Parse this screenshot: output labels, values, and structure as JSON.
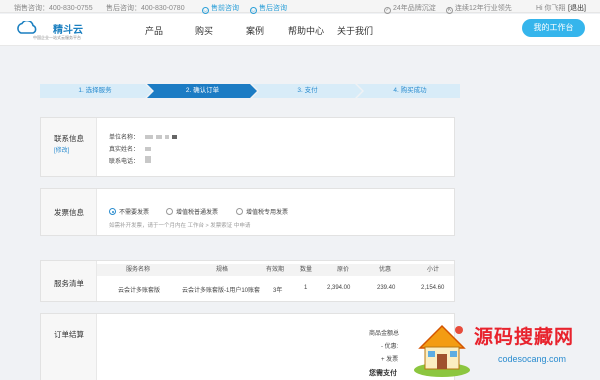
{
  "topbar": {
    "sales_phone": "销售咨询：400-830-0755",
    "aftersales_phone": "售后咨询：400-830-0780",
    "presale_link": "售前咨询",
    "postsale_link": "售后咨询",
    "service_badge": "24年品牌沉淀",
    "industry_badge": "连续12年行业领先",
    "user_greeting": "Hi 你飞翔",
    "logout_link": "[退出]"
  },
  "header": {
    "logo_name": "精斗云",
    "logo_tagline": "中国企业一站式云服务平台",
    "nav": [
      "产品",
      "购买",
      "案例",
      "帮助中心",
      "关于我们"
    ],
    "workspace_button": "我的工作台"
  },
  "steps": [
    {
      "label": "1. 选择服务",
      "active": false
    },
    {
      "label": "2. 确认订单",
      "active": true
    },
    {
      "label": "3. 支付",
      "active": false
    },
    {
      "label": "4. 购买成功",
      "active": false
    }
  ],
  "contact": {
    "title": "联系信息",
    "edit": "[修改]",
    "fields": [
      "单位名称：",
      "真实姓名：",
      "联系电话："
    ]
  },
  "invoice": {
    "title": "发票信息",
    "options": [
      {
        "label": "不需要发票",
        "selected": true
      },
      {
        "label": "增值税普通发票",
        "selected": false
      },
      {
        "label": "增值税专用发票",
        "selected": false
      }
    ],
    "note": "如需补开发票，请于一个月内在 工作台 > 发票索证 中申请"
  },
  "service_list": {
    "title": "服务清单",
    "columns": [
      "服务名称",
      "规格",
      "有效期",
      "数量",
      "原价",
      "优惠",
      "小计"
    ],
    "rows": [
      [
        "云会计多账套版",
        "云会计多账套版-1用户10账套",
        "3年",
        "1",
        "2,394.00",
        "239.40",
        "2,154.60"
      ]
    ]
  },
  "settlement": {
    "title": "订单结算",
    "lines": [
      "商品金额总",
      "- 优惠:",
      "+ 发票"
    ],
    "total_label": "您需支付"
  },
  "watermark": {
    "title": "源码搜藏网",
    "url": "codesocang.com"
  },
  "colors": {
    "accent": "#2a8ccf",
    "button": "#35b5ec",
    "step_active": "#1c7cc4",
    "step_inactive": "#d8ecf8",
    "watermark_red": "#e8232d"
  }
}
